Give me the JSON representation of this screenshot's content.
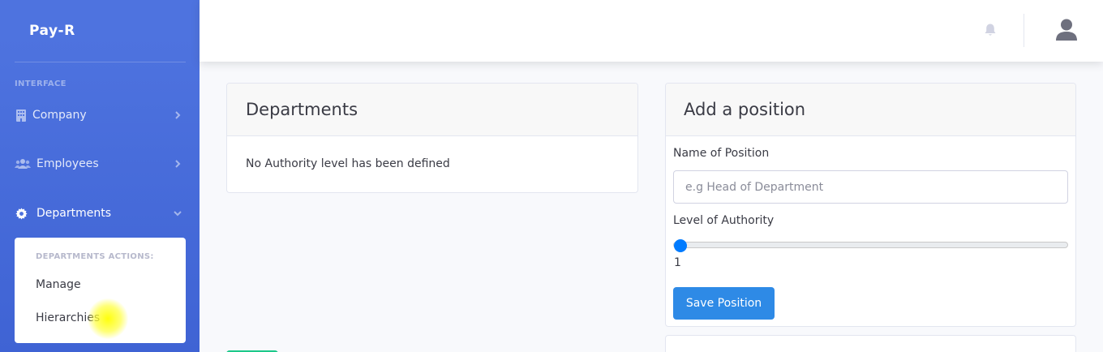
{
  "sidebar": {
    "brand": "Pay-R",
    "heading": "INTERFACE",
    "items": [
      {
        "label": "Company",
        "icon": "building-icon"
      },
      {
        "label": "Employees",
        "icon": "users-icon"
      },
      {
        "label": "Departments",
        "icon": "gear-icon"
      }
    ],
    "departments_actions": {
      "header": "DEPARTMENTS ACTIONS:",
      "items": [
        "Manage",
        "Hierarchies"
      ]
    }
  },
  "topbar": {
    "bell_icon": "bell-icon",
    "avatar_icon": "user-icon"
  },
  "departments_card": {
    "title": "Departments",
    "empty_message": "No Authority level has been defined"
  },
  "position_card": {
    "title": "Add a position",
    "name_label": "Name of Position",
    "name_placeholder": "e.g Head of Department",
    "name_value": "",
    "authority_label": "Level of Authority",
    "authority_value": "1",
    "save_label": "Save Position"
  },
  "colors": {
    "sidebar": "#4e73df",
    "primary_button": "#2e8ae6",
    "slider_thumb": "#007bff"
  }
}
